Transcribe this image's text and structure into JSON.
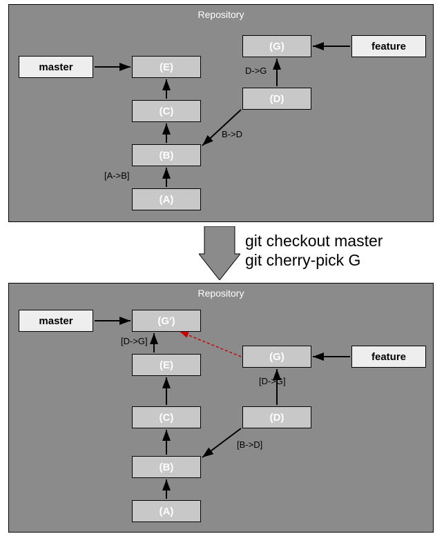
{
  "repo1": {
    "title": "Repository",
    "branches": {
      "master": "master",
      "feature": "feature"
    },
    "commits": {
      "A": "(A)",
      "B": "(B)",
      "C": "(C)",
      "D": "(D)",
      "E": "(E)",
      "G": "(G)"
    },
    "edges": {
      "AB": "[A->B]",
      "BD": "B->D",
      "DG": "D->G"
    }
  },
  "commands": {
    "line1": "git checkout master",
    "line2": "git cherry-pick G"
  },
  "repo2": {
    "title": "Repository",
    "branches": {
      "master": "master",
      "feature": "feature"
    },
    "commits": {
      "A": "(A)",
      "B": "(B)",
      "C": "(C)",
      "D": "(D)",
      "E": "(E)",
      "G": "(G)",
      "Gp": "(G')"
    },
    "edges": {
      "DGp": "[D->G]",
      "DG": "[D->G]",
      "BD": "[B->D]"
    }
  }
}
